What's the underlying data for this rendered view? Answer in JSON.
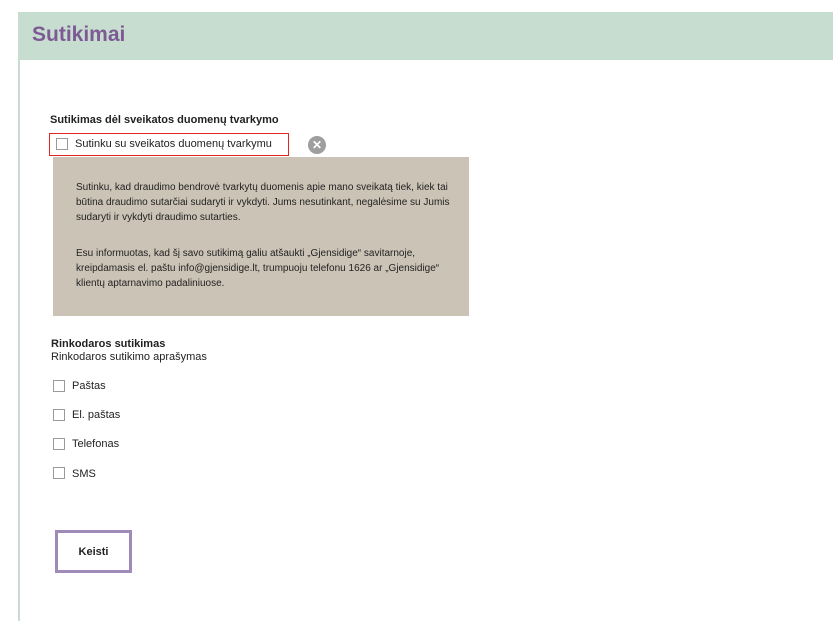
{
  "header": {
    "title": "Sutikimai"
  },
  "health_consent": {
    "title": "Sutikimas dėl sveikatos duomenų tvarkymo",
    "checkbox_label": "Sutinku su sveikatos duomenų tvarkymu",
    "checked": false,
    "info": {
      "paragraph1": "Sutinku, kad draudimo bendrovė tvarkytų duomenis apie mano sveikatą tiek, kiek tai būtina draudimo sutarčiai sudaryti ir vykdyti. Jums nesutinkant, negalėsime su Jumis sudaryti ir vykdyti draudimo sutarties.",
      "paragraph2": "Esu informuotas, kad šį savo sutikimą galiu atšaukti „Gjensidige“ savitarnoje, kreipdamasis el. paštu info@gjensidige.lt, trumpuoju telefonu 1626 ar „Gjensidige“ klientų aptarnavimo padaliniuose."
    },
    "close_icon": "close-circle-icon"
  },
  "marketing": {
    "title": "Rinkodaros sutikimas",
    "description": "Rinkodaros sutikimo aprašymas",
    "options": [
      {
        "label": "Paštas",
        "checked": false
      },
      {
        "label": "El. paštas",
        "checked": false
      },
      {
        "label": "Telefonas",
        "checked": false
      },
      {
        "label": "SMS",
        "checked": false
      }
    ]
  },
  "actions": {
    "change_label": "Keisti"
  },
  "colors": {
    "header_bg": "#c7ddd0",
    "header_title": "#7e5a95",
    "info_bg": "#cbc3b6",
    "highlight_border": "#e2271e",
    "button_border": "#9f8bb9"
  }
}
